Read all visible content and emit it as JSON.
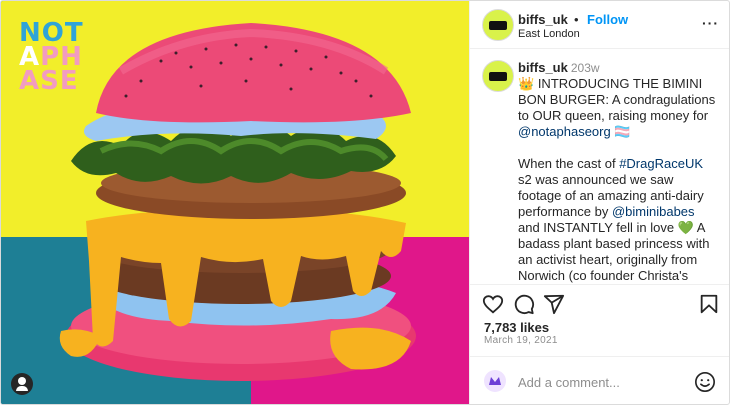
{
  "media": {
    "brand_lines": [
      "NOT",
      "A",
      "PH",
      "ASE"
    ],
    "brand_colors": {
      "top": "#2fa4d8",
      "bottom": "#f29cc0",
      "a": "#ffffff"
    },
    "tag_icon": "user-tag-icon"
  },
  "header": {
    "username": "biffs_uk",
    "separator": "•",
    "follow_label": "Follow",
    "location": "East London",
    "more_icon": "more-options-icon",
    "more_label": "···"
  },
  "caption": {
    "username": "biffs_uk",
    "time": "203w",
    "crown": "👑",
    "intro": "INTRODUCING THE BIMINI BON BURGER: A condragulations to OUR queen, raising money for",
    "mention1": "@notaphaseorg",
    "flag": "🏳️‍⚧️",
    "p2_a": "When the cast of",
    "hashtag": "#DragRaceUK",
    "p2_b": "s2 was announced we saw footage of an amazing anti-dairy performance by",
    "mention2": "@biminibabes",
    "p2_c": "and INSTANTLY fell in love",
    "heart": "💚",
    "p2_d": "A badass plant based princess with an activist heart, originally from Norwich (co founder Christa's home) and now repping East London? We were IN before the show even started. And when Bimini told us they were a regular"
  },
  "actions": {
    "like_icon": "heart-icon",
    "comment_icon": "comment-icon",
    "share_icon": "share-icon",
    "save_icon": "bookmark-icon"
  },
  "stats": {
    "likes": "7,783 likes",
    "date": "March 19, 2021"
  },
  "comment": {
    "placeholder": "Add a comment...",
    "emoji_icon": "emoji-icon"
  },
  "colors": {
    "accent": "#0095f6",
    "mention": "#00376b",
    "muted": "#8e8e8e",
    "bg_yellow": "#f2ee2a",
    "bg_teal": "#1e7f95",
    "bg_magenta": "#e0178a"
  }
}
